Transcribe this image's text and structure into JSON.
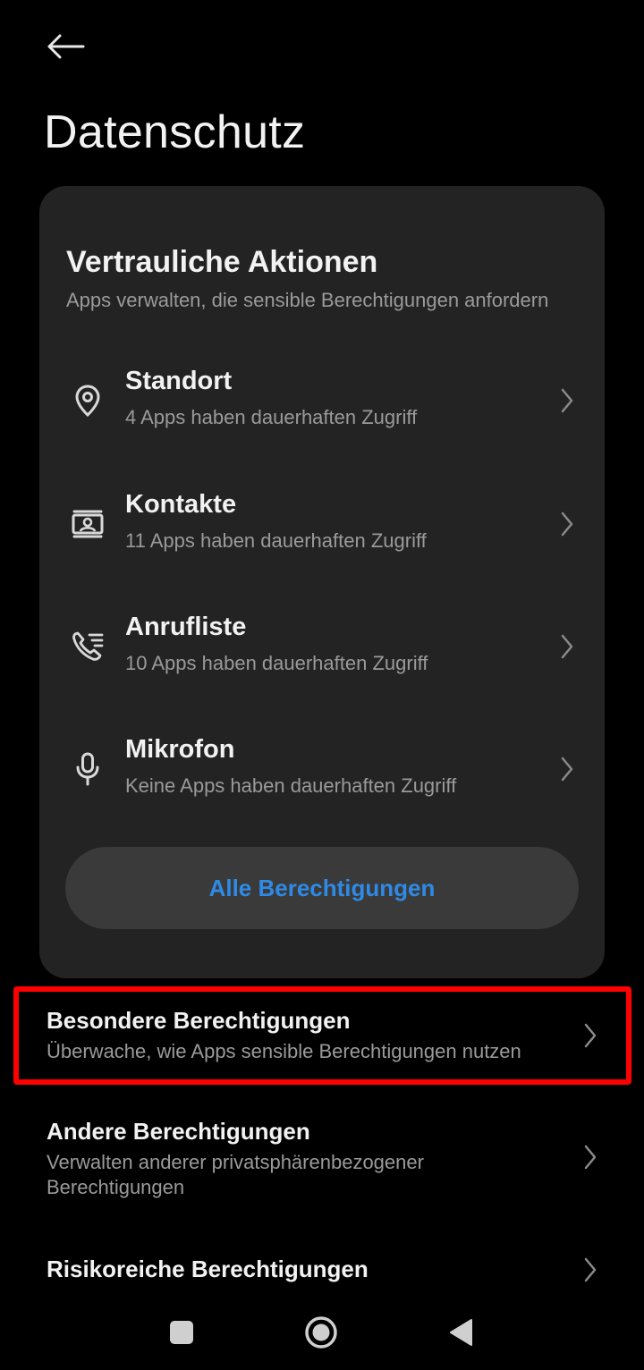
{
  "header": {
    "back_icon": "arrow-left-icon",
    "title": "Datenschutz"
  },
  "card": {
    "title": "Vertrauliche Aktionen",
    "subtitle": "Apps verwalten, die sensible Berechtigungen anfordern",
    "items": [
      {
        "icon": "location-pin-icon",
        "title": "Standort",
        "subtitle": "4 Apps haben dauerhaften Zugriff"
      },
      {
        "icon": "contacts-card-icon",
        "title": "Kontakte",
        "subtitle": "11 Apps haben dauerhaften Zugriff"
      },
      {
        "icon": "call-log-icon",
        "title": "Anrufliste",
        "subtitle": "10 Apps haben dauerhaften Zugriff"
      },
      {
        "icon": "microphone-icon",
        "title": "Mikrofon",
        "subtitle": "Keine Apps haben dauerhaften Zugriff"
      }
    ],
    "button_label": "Alle Berechtigungen",
    "button_color": "#2e8ae6"
  },
  "list": [
    {
      "title": "Besondere Berechtigungen",
      "subtitle": "Überwache, wie Apps sensible Berechtigungen nutzen",
      "highlighted": true
    },
    {
      "title": "Andere Berechtigungen",
      "subtitle": "Verwalten anderer privatsphärenbezogener Berechtigungen"
    },
    {
      "title": "Risikoreiche Berechtigungen"
    }
  ],
  "colors": {
    "background": "#000000",
    "card": "#232323",
    "highlight_border": "#ff0000"
  },
  "navbar": {
    "icons": [
      "recents-square-icon",
      "home-circle-icon",
      "back-triangle-icon"
    ]
  }
}
